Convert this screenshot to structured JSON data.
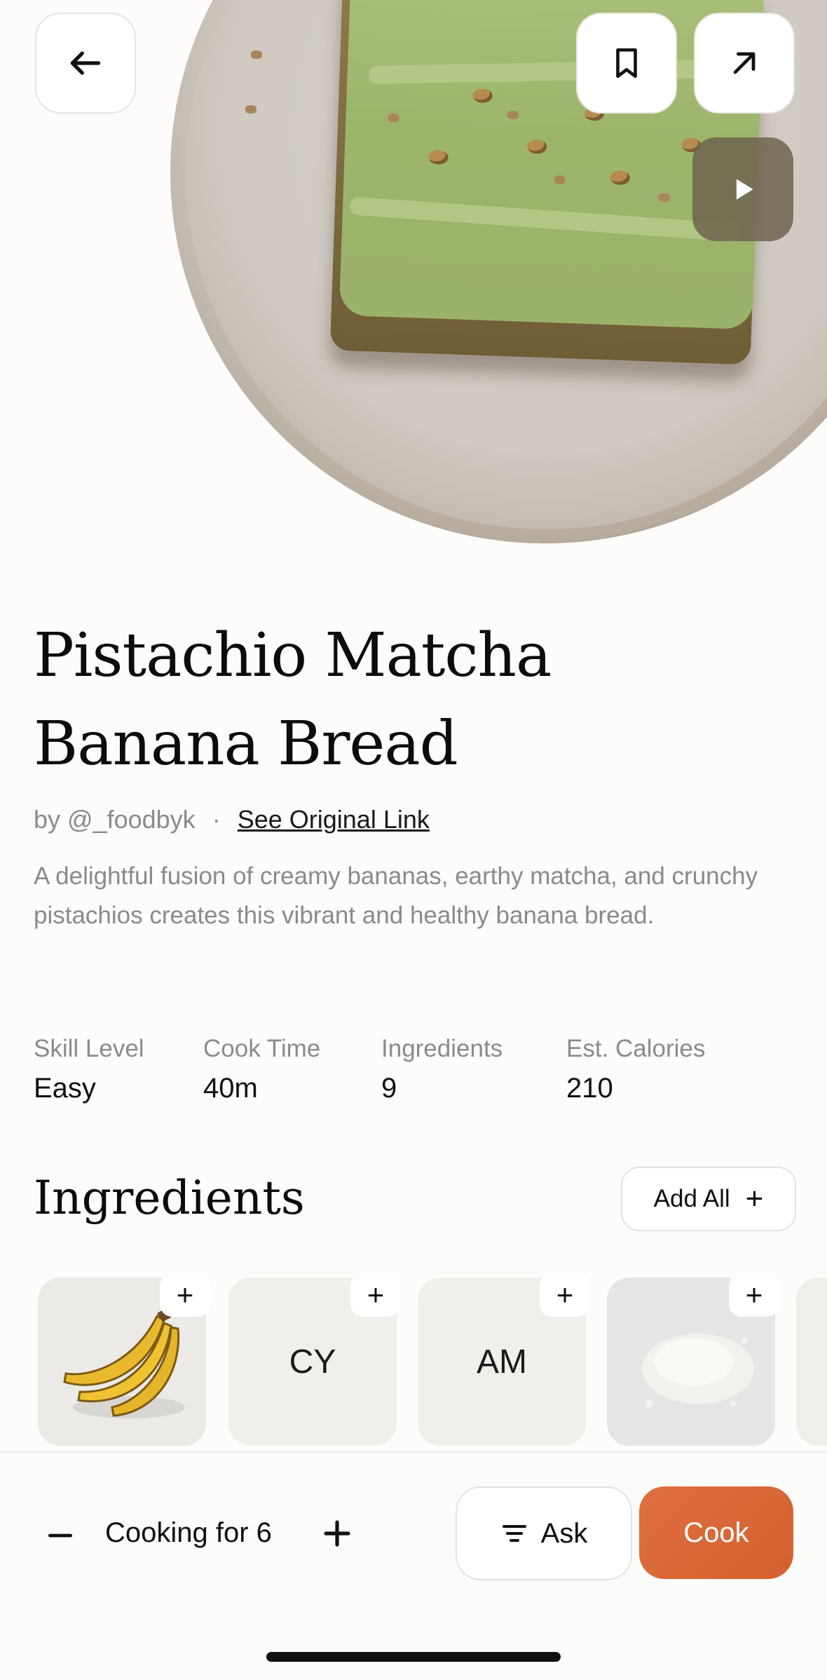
{
  "hero": {
    "image_alt": "Pistachio matcha banana bread on a plate",
    "icons": {
      "back": "arrow-left-icon",
      "bookmark": "bookmark-icon",
      "share": "arrow-up-right-icon",
      "play": "play-icon"
    }
  },
  "recipe": {
    "title_line1": "Pistachio Matcha",
    "title_line2": "Banana Bread",
    "author": "by @_foodbyk",
    "separator": "·",
    "original_link": "See Original Link",
    "description": "A delightful fusion of creamy bananas, earthy matcha, and crunchy pistachios creates this vibrant and healthy banana bread."
  },
  "stats": [
    {
      "label": "Skill Level",
      "value": "Easy"
    },
    {
      "label": "Cook Time",
      "value": "40m"
    },
    {
      "label": "Ingredients",
      "value": "9"
    },
    {
      "label": "Est. Calories",
      "value": "210"
    }
  ],
  "ingredients": {
    "heading": "Ingredients",
    "add_all_label": "Add All",
    "add_icon": "+",
    "cards": [
      {
        "kind": "image",
        "image": "bananas",
        "text": ""
      },
      {
        "kind": "text",
        "text": "CY"
      },
      {
        "kind": "text",
        "text": "AM"
      },
      {
        "kind": "image",
        "image": "flour",
        "text": ""
      }
    ]
  },
  "bottom_bar": {
    "cooking_for": "Cooking for 6",
    "ask_label": "Ask",
    "cook_label": "Cook"
  },
  "colors": {
    "accent": "#d9643a",
    "text": "#111111",
    "muted": "#8a8a8a",
    "card_bg": "#f0efea"
  }
}
